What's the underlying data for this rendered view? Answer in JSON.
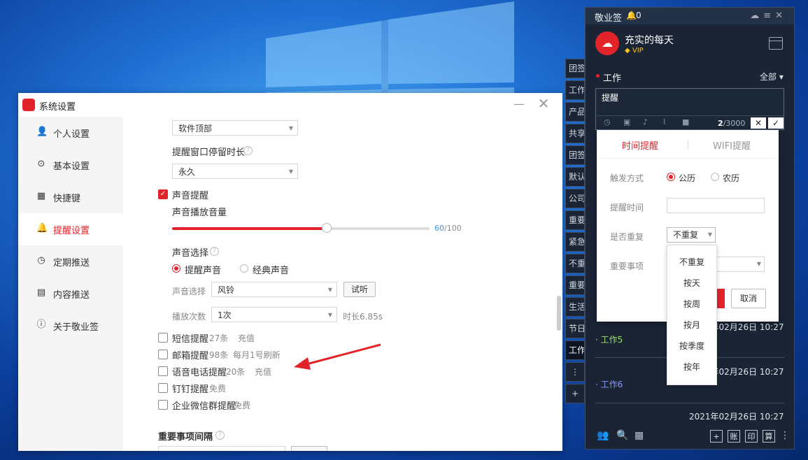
{
  "settings_window": {
    "title": "系统设置",
    "nav": [
      {
        "label": "个人设置",
        "icon": "user-icon"
      },
      {
        "label": "基本设置",
        "icon": "settings-icon"
      },
      {
        "label": "快捷键",
        "icon": "keyboard-icon"
      },
      {
        "label": "提醒设置",
        "icon": "bell-icon",
        "active": true
      },
      {
        "label": "定期推送",
        "icon": "schedule-icon"
      },
      {
        "label": "内容推送",
        "icon": "document-icon"
      },
      {
        "label": "关于敬业签",
        "icon": "info-icon"
      }
    ],
    "content": {
      "position_select": "软件顶部",
      "dwell_label": "提醒窗口停留时长",
      "dwell_select": "永久",
      "sound_reminder": "声音提醒",
      "volume_label": "声音播放音量",
      "volume_value": "60",
      "volume_max": "/100",
      "volume_level": 0.6,
      "sound_choice_label": "声音选择",
      "radio_reminder": "提醒声音",
      "radio_classic": "经典声音",
      "sound_select_label": "声音选择",
      "sound_select_value": "风铃",
      "preview_button": "试听",
      "play_count_label": "播放次数",
      "play_count_value": "1次",
      "duration": "时长6.85s",
      "channels": [
        {
          "label": "短信提醒",
          "count": "27条",
          "extra": "充值"
        },
        {
          "label": "邮箱提醒",
          "count": "98条",
          "extra": "每月1号刷新"
        },
        {
          "label": "语音电话提醒",
          "count": "20条",
          "extra": "充值"
        },
        {
          "label": "钉钉提醒",
          "count": "免费",
          "extra": ""
        },
        {
          "label": "企业微信群提醒",
          "count": "免费",
          "extra": ""
        }
      ],
      "important_interval": "重要事项间隔"
    }
  },
  "note_app": {
    "brand": "敬业签",
    "bell_count": "0",
    "username": "充实的每天",
    "vip": "VIP",
    "category": "工作",
    "filter": "全部",
    "editor_text": "提醒",
    "counter_current": "2",
    "counter_max": "/3000",
    "side_tabs": [
      "团签",
      "工作",
      "产品",
      "共享",
      "团签",
      "默认",
      "公司",
      "重要",
      "紧急",
      "不重",
      "重要",
      "生活",
      "节日",
      "工作",
      "⋮",
      "+"
    ],
    "notes": [
      {
        "title": "工作5",
        "date": "2021年02月26日 10:27",
        "color": "#9be36b"
      },
      {
        "title": "工作6",
        "date": "2021年02月26日 10:27",
        "color": "#8d9cff"
      },
      {
        "title": "",
        "date": "2021年02月26日 10:27",
        "color": "#ffffff"
      }
    ],
    "bottom_buttons": [
      "+",
      "账",
      "印",
      "算",
      "⋮"
    ]
  },
  "popup": {
    "tab_time": "时间提醒",
    "tab_wifi": "WIFI提醒",
    "trigger_label": "触发方式",
    "solar": "公历",
    "lunar": "农历",
    "time_label": "提醒时间",
    "repeat_label": "是否重复",
    "repeat_value": "不重复",
    "important_label": "重要事项",
    "cancel": "取消",
    "repeat_options": [
      "不重复",
      "按天",
      "按周",
      "按月",
      "按季度",
      "按年"
    ]
  },
  "colors": {
    "accent": "#e2232a",
    "dark_panel": "#1a2434"
  }
}
